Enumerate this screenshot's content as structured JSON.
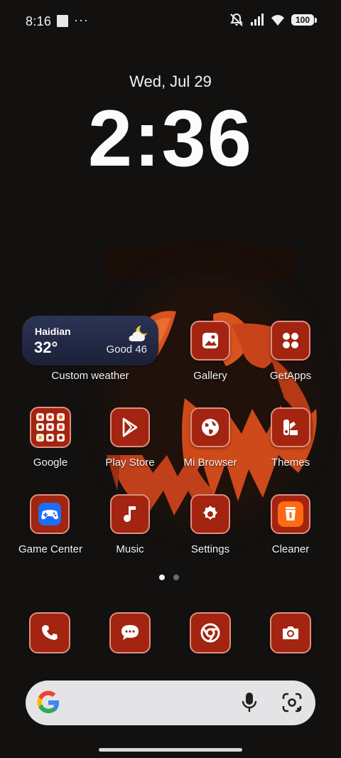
{
  "status_bar": {
    "time": "8:16",
    "overflow": "···",
    "battery": "100",
    "icons": [
      "photo-icon",
      "mute-icon",
      "signal-icon",
      "wifi-icon",
      "battery-icon"
    ]
  },
  "lockclock": {
    "date": "Wed, Jul 29",
    "time": "2:36"
  },
  "weather_widget": {
    "city": "Haidian",
    "temperature": "32°",
    "air_quality": "Good 46",
    "icon": "partly-cloudy-night-icon",
    "label": "Custom weather"
  },
  "apps": {
    "gallery": "Gallery",
    "getapps": "GetApps",
    "google": "Google",
    "play_store": "Play Store",
    "mi_browser": "Mi Browser",
    "themes": "Themes",
    "game_center": "Game Center",
    "music": "Music",
    "settings": "Settings",
    "cleaner": "Cleaner"
  },
  "page_indicator": {
    "pages": 2,
    "current": 1
  },
  "dock": [
    "phone-icon",
    "messages-icon",
    "chrome-icon",
    "camera-icon"
  ],
  "search_bar": {
    "icons": [
      "google-g-icon",
      "mic-icon",
      "lens-icon"
    ]
  },
  "colors": {
    "icon_bg": "#a32410",
    "icon_border": "#e08f80",
    "background": "#121110",
    "weather_bg": "#242a47"
  }
}
